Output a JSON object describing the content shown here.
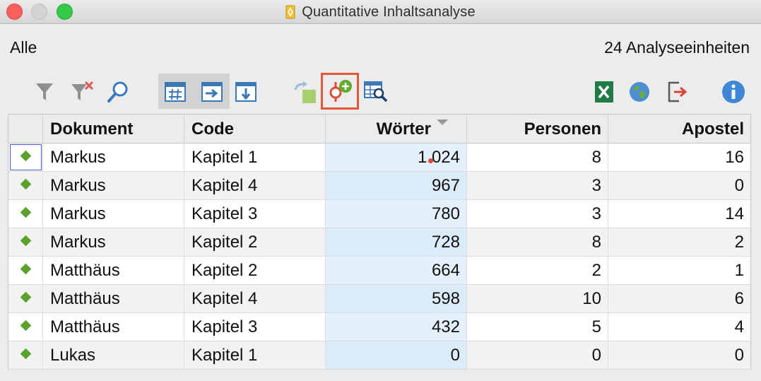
{
  "window": {
    "title": "Quantitative Inhaltsanalyse"
  },
  "header": {
    "filter_label": "Alle",
    "count_label": "24 Analyseeinheiten"
  },
  "toolbar": {
    "icons": [
      "filter-icon",
      "clear-filter-icon",
      "search-icon",
      "frequency-table-icon",
      "arrow-right-icon",
      "arrow-down-icon",
      "transfer-variable-icon",
      "add-code-icon",
      "table-search-icon",
      "excel-export-icon",
      "web-export-icon",
      "export-icon",
      "info-icon"
    ],
    "highlighted": "add-code-icon"
  },
  "table": {
    "columns": [
      "",
      "Dokument",
      "Code",
      "Wörter",
      "Personen",
      "Apostel"
    ],
    "sorted_column": "Wörter",
    "rows": [
      {
        "dokument": "Markus",
        "code": "Kapitel 1",
        "woerter": "1.024",
        "personen": "8",
        "apostel": "16"
      },
      {
        "dokument": "Markus",
        "code": "Kapitel 4",
        "woerter": "967",
        "personen": "3",
        "apostel": "0"
      },
      {
        "dokument": "Markus",
        "code": "Kapitel 3",
        "woerter": "780",
        "personen": "3",
        "apostel": "14"
      },
      {
        "dokument": "Markus",
        "code": "Kapitel 2",
        "woerter": "728",
        "personen": "8",
        "apostel": "2"
      },
      {
        "dokument": "Matthäus",
        "code": "Kapitel 2",
        "woerter": "664",
        "personen": "2",
        "apostel": "1"
      },
      {
        "dokument": "Matthäus",
        "code": "Kapitel 4",
        "woerter": "598",
        "personen": "10",
        "apostel": "6"
      },
      {
        "dokument": "Matthäus",
        "code": "Kapitel 3",
        "woerter": "432",
        "personen": "5",
        "apostel": "4"
      },
      {
        "dokument": "Lukas",
        "code": "Kapitel 1",
        "woerter": "0",
        "personen": "0",
        "apostel": "0"
      }
    ]
  },
  "colors": {
    "accent_highlight": "#e2563b",
    "row_marker": "#5aa12c",
    "sorted_column_bg": "#e4f0fb"
  }
}
